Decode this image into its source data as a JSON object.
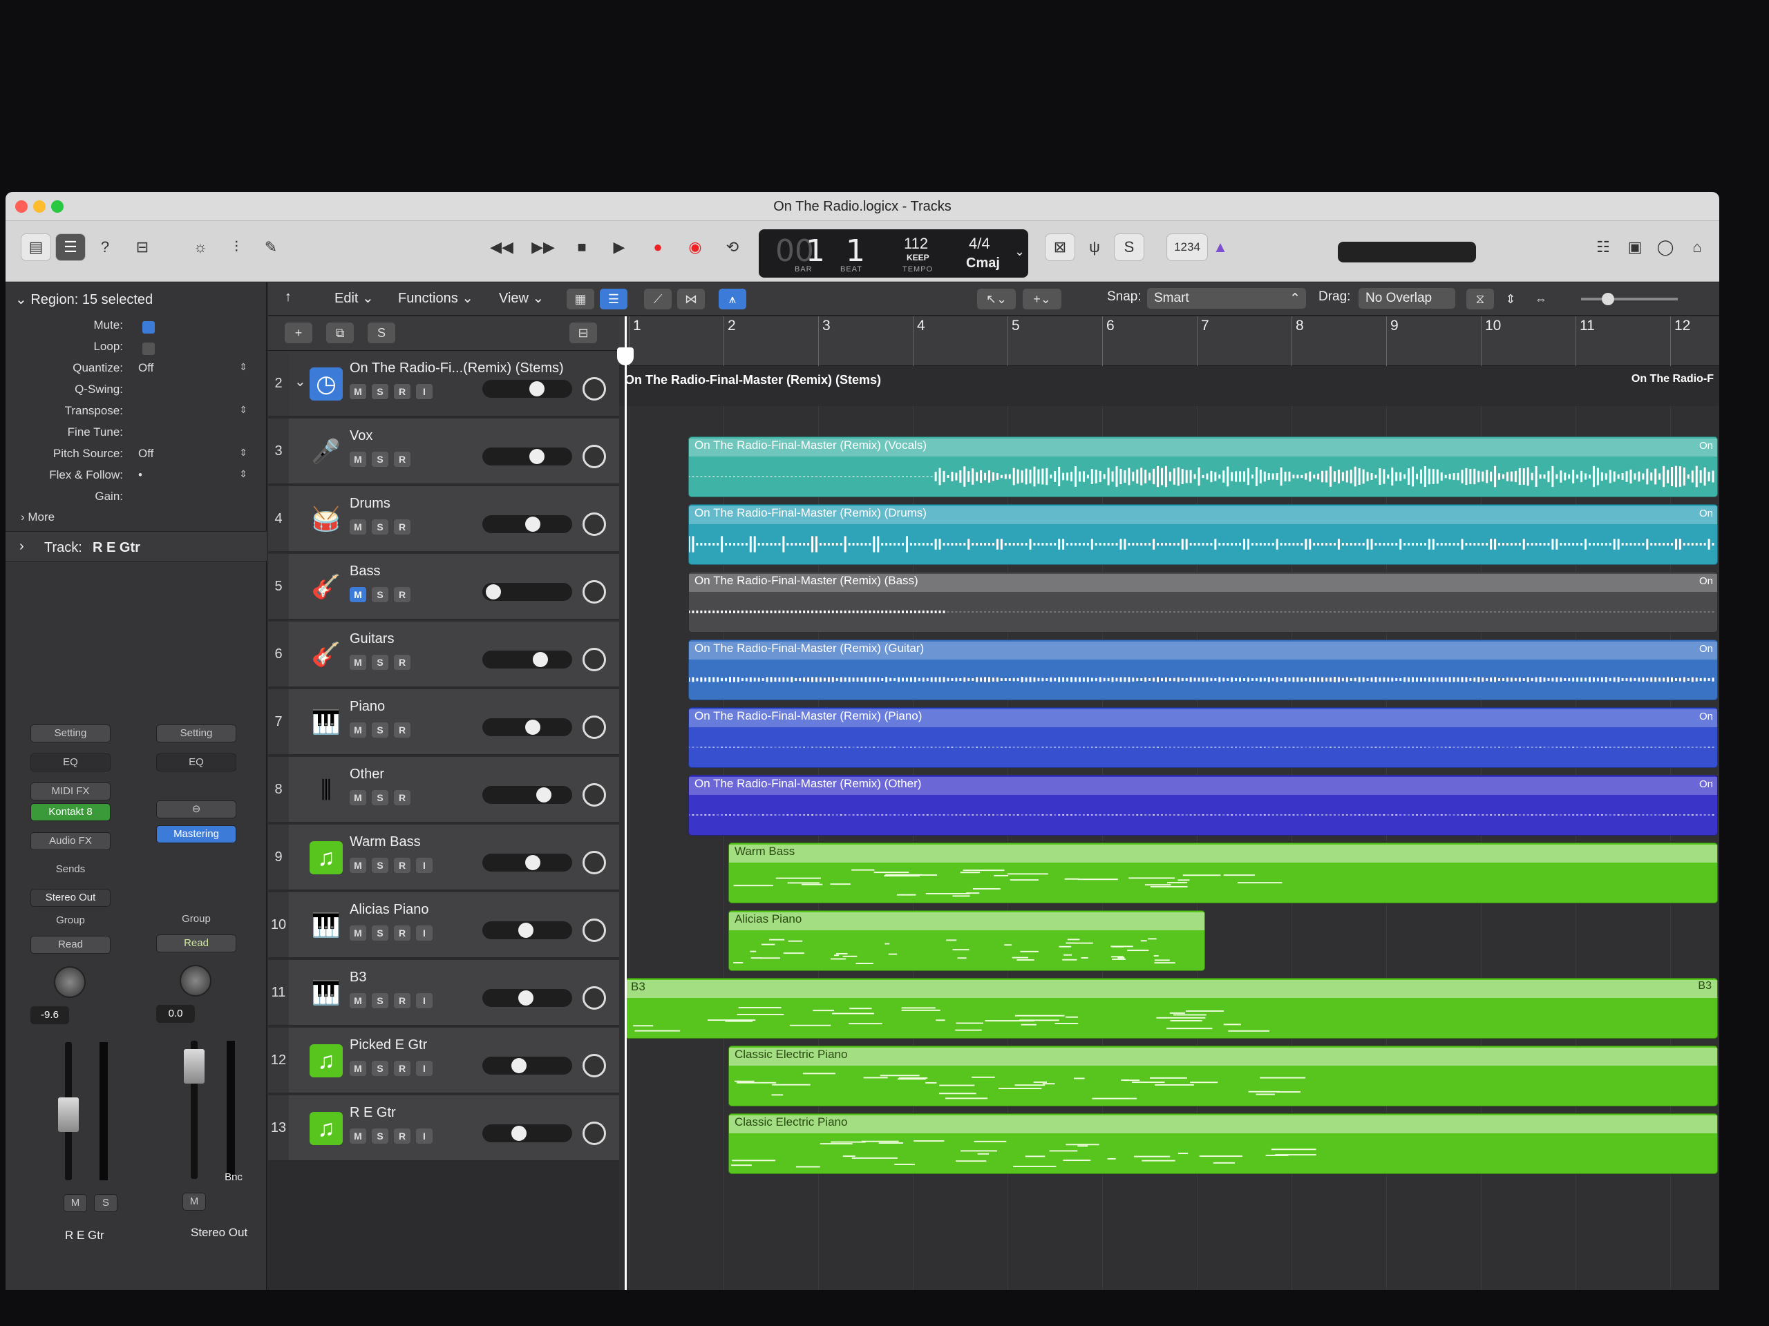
{
  "window": {
    "title": "On The Radio.logicx - Tracks"
  },
  "lcd": {
    "bar": "1",
    "bar_dim": "00",
    "beat": "1",
    "bar_label": "BAR",
    "beat_label": "BEAT",
    "tempo": "112",
    "tempo_sub": "KEEP",
    "tempo_label": "TEMPO",
    "time_sig": "4/4",
    "key": "Cmaj"
  },
  "toolbar": {
    "count_in": "1234"
  },
  "inspector": {
    "region_header": "Region: 15 selected",
    "rows": [
      {
        "label": "Mute:",
        "value": ""
      },
      {
        "label": "Loop:",
        "value": ""
      },
      {
        "label": "Quantize:",
        "value": "Off"
      },
      {
        "label": "Q-Swing:",
        "value": ""
      },
      {
        "label": "Transpose:",
        "value": ""
      },
      {
        "label": "Fine Tune:",
        "value": ""
      },
      {
        "label": "Pitch Source:",
        "value": "Off"
      },
      {
        "label": "Flex & Follow:",
        "value": "•"
      },
      {
        "label": "Gain:",
        "value": ""
      }
    ],
    "more": "More",
    "track_header": "Track:",
    "track_name": "R E Gtr"
  },
  "strip_left": {
    "setting": "Setting",
    "eq": "EQ",
    "midi_fx": "MIDI FX",
    "instrument": "Kontakt 8",
    "audio_fx": "Audio FX",
    "sends": "Sends",
    "output": "Stereo Out",
    "group": "Group",
    "automation": "Read",
    "volume": "-9.6",
    "mute": "M",
    "solo": "S",
    "name": "R E Gtr"
  },
  "strip_right": {
    "setting": "Setting",
    "eq": "EQ",
    "plugin": "Mastering",
    "group": "Group",
    "automation": "Read",
    "volume": "0.0",
    "mute": "M",
    "bounce": "Bnc",
    "name": "Stereo Out"
  },
  "fader_scale": [
    "0",
    "3",
    "6",
    "9",
    "12",
    "15",
    "18",
    "21",
    "24",
    "30",
    "35",
    "40",
    "45",
    "50",
    "60"
  ],
  "editbar": {
    "edit": "Edit",
    "functions": "Functions",
    "view": "View",
    "snap_label": "Snap:",
    "snap_value": "Smart",
    "drag_label": "Drag:",
    "drag_value": "No Overlap"
  },
  "tracklist_header": {
    "add": "+",
    "dup": "⧉",
    "solo": "S"
  },
  "tracks": [
    {
      "num": "2",
      "name": "On The Radio-Fi...(Remix) (Stems)",
      "buttons": [
        "M",
        "S",
        "R",
        "I"
      ],
      "icon": "folder-stack-icon"
    },
    {
      "num": "3",
      "name": "Vox",
      "buttons": [
        "M",
        "S",
        "R"
      ],
      "icon": "singer-icon"
    },
    {
      "num": "4",
      "name": "Drums",
      "buttons": [
        "M",
        "S",
        "R"
      ],
      "icon": "drum-kit-icon"
    },
    {
      "num": "5",
      "name": "Bass",
      "buttons": [
        "M",
        "S",
        "R"
      ],
      "icon": "bass-guitar-icon",
      "muted": true
    },
    {
      "num": "6",
      "name": "Guitars",
      "buttons": [
        "M",
        "S",
        "R"
      ],
      "icon": "guitar-icon"
    },
    {
      "num": "7",
      "name": "Piano",
      "buttons": [
        "M",
        "S",
        "R"
      ],
      "icon": "grand-piano-icon"
    },
    {
      "num": "8",
      "name": "Other",
      "buttons": [
        "M",
        "S",
        "R"
      ],
      "icon": "waveform-icon"
    },
    {
      "num": "9",
      "name": "Warm Bass",
      "buttons": [
        "M",
        "S",
        "R",
        "I"
      ],
      "icon": "midi-note-icon"
    },
    {
      "num": "10",
      "name": "Alicias Piano",
      "buttons": [
        "M",
        "S",
        "R",
        "I"
      ],
      "icon": "grand-piano-icon"
    },
    {
      "num": "11",
      "name": "B3",
      "buttons": [
        "M",
        "S",
        "R",
        "I"
      ],
      "icon": "organ-icon"
    },
    {
      "num": "12",
      "name": "Picked E Gtr",
      "buttons": [
        "M",
        "S",
        "R",
        "I"
      ],
      "icon": "midi-note-icon"
    },
    {
      "num": "13",
      "name": "R E Gtr",
      "buttons": [
        "M",
        "S",
        "R",
        "I"
      ],
      "icon": "midi-note-icon"
    }
  ],
  "ruler": [
    "1",
    "2",
    "3",
    "4",
    "5",
    "6",
    "7",
    "8",
    "9",
    "10",
    "11",
    "12"
  ],
  "regions": [
    {
      "name": "On The Radio-Final-Master (Remix) (Stems)",
      "name_right": "On The Radio-F"
    },
    {
      "name": "On The Radio-Final-Master (Remix) (Vocals)",
      "tag": "On"
    },
    {
      "name": "On The Radio-Final-Master (Remix) (Drums)",
      "tag": "On"
    },
    {
      "name": "On The Radio-Final-Master (Remix) (Bass)",
      "tag": "On"
    },
    {
      "name": "On The Radio-Final-Master (Remix) (Guitar)",
      "tag": "On"
    },
    {
      "name": "On The Radio-Final-Master (Remix) (Piano)",
      "tag": "On"
    },
    {
      "name": "On The Radio-Final-Master (Remix) (Other)",
      "tag": "On"
    },
    {
      "name": "Warm Bass"
    },
    {
      "name": "Alicias Piano"
    },
    {
      "name": "B3",
      "name_right": "B3"
    },
    {
      "name": "Classic Electric Piano"
    },
    {
      "name": "Classic Electric Piano"
    }
  ],
  "colors": {
    "vocals": "#3fb3a6",
    "drums": "#2fa3b8",
    "bass": "#4a4a4c",
    "guitar": "#3a72c4",
    "piano": "#3650d0",
    "other": "#3a35c8",
    "midi_green": "#58c41e",
    "accent_blue": "#3d7bd8"
  }
}
